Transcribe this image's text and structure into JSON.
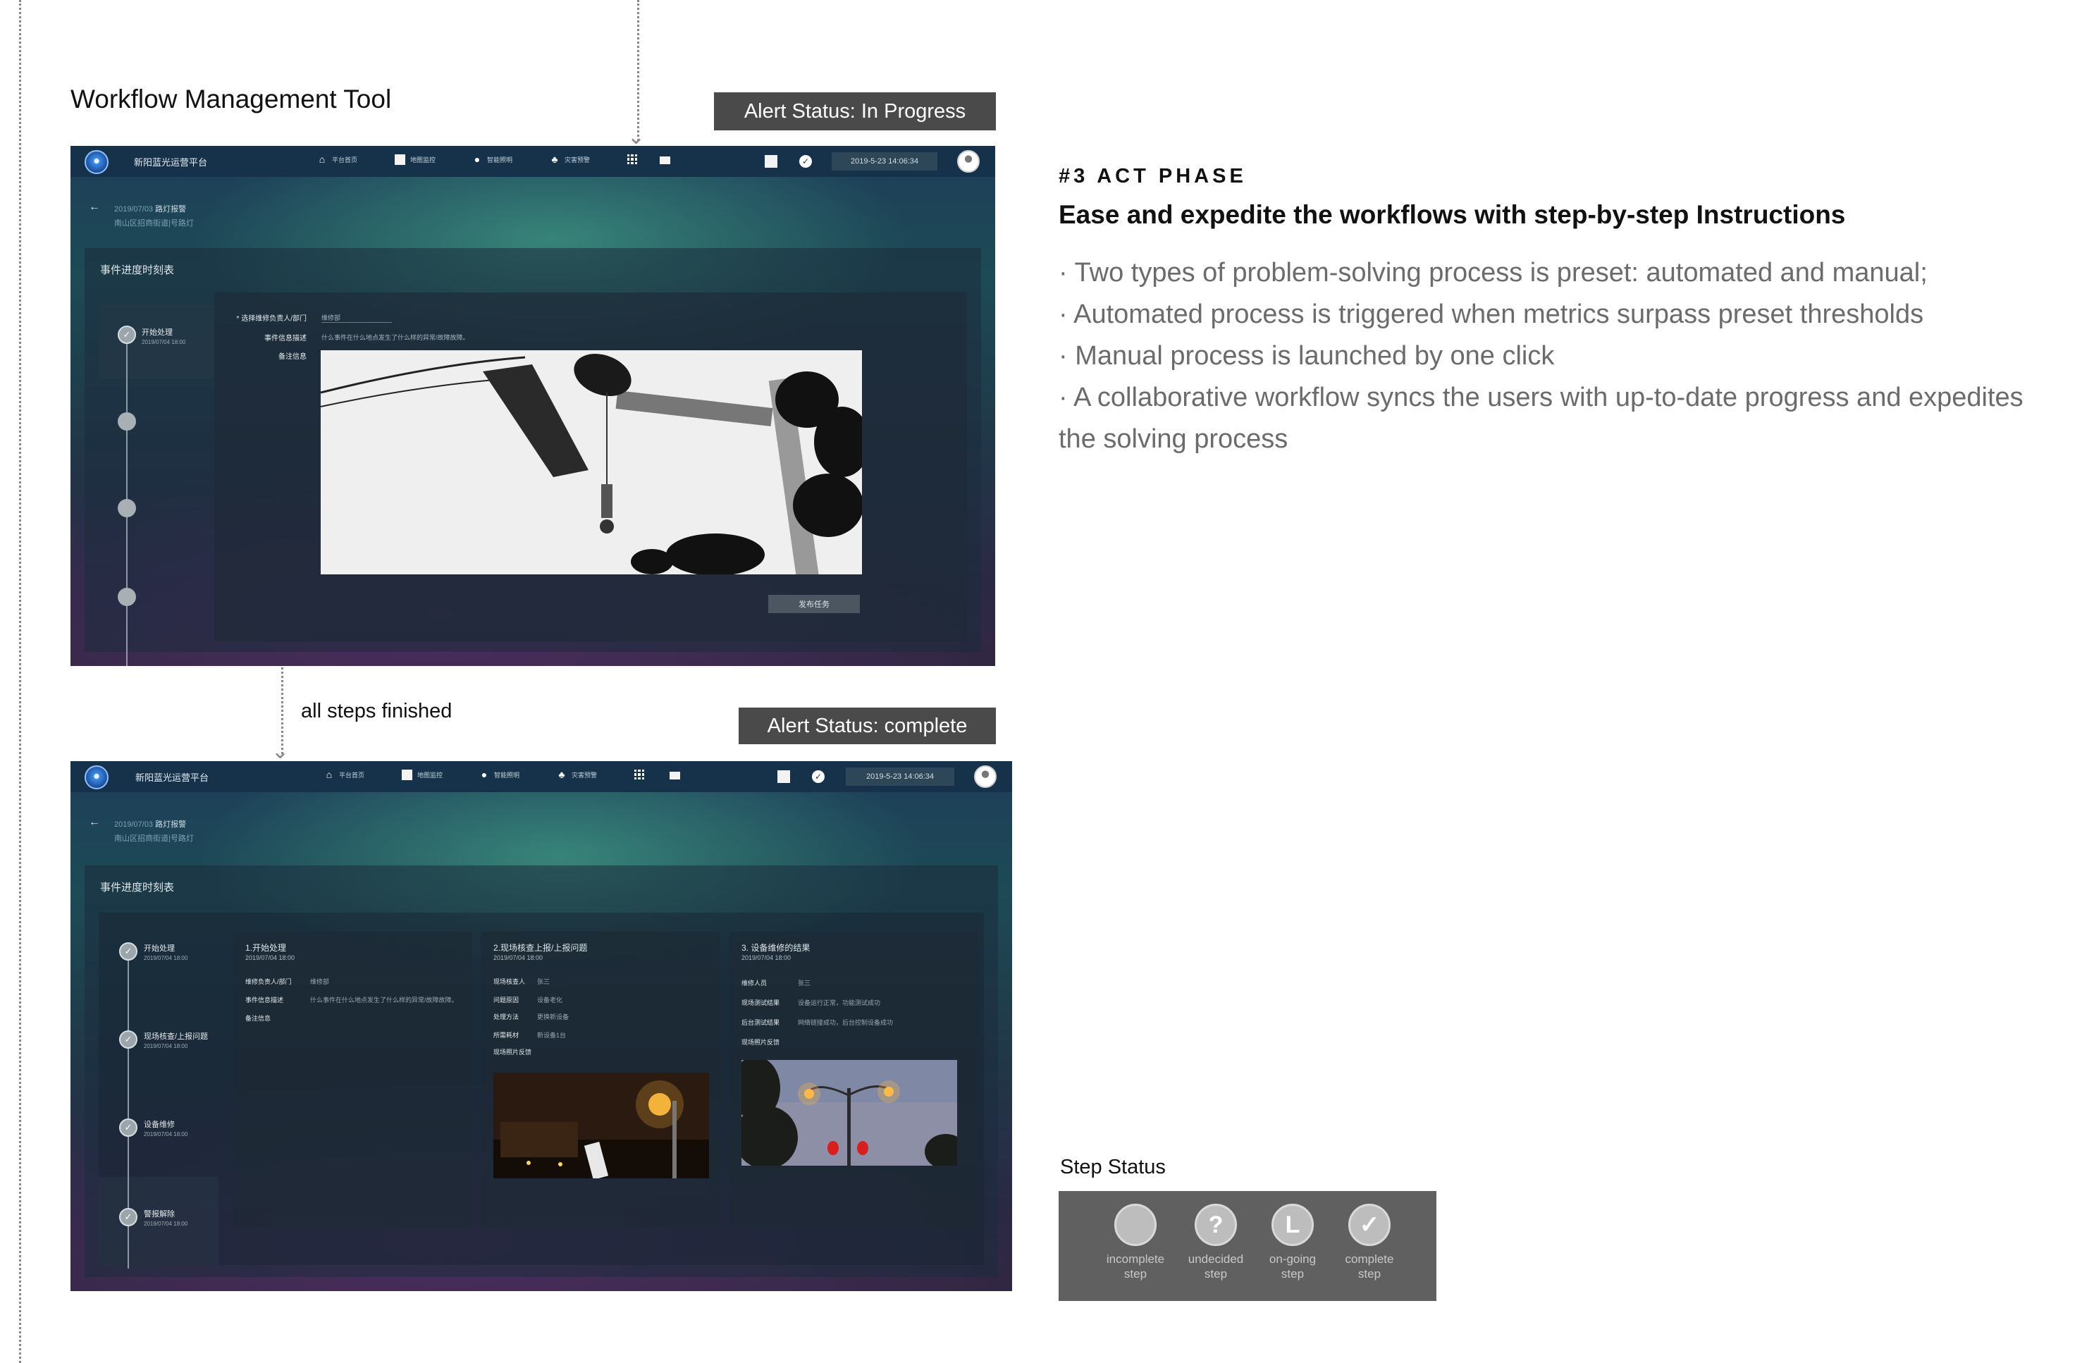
{
  "section_title": "Workflow Management Tool",
  "status_in_progress": "Alert Status: In Progress",
  "status_complete": "Alert Status: complete",
  "transition_label": "all steps finished",
  "phase_label": "#3 ACT PHASE",
  "headline": "Ease and expedite the workflows with step-by-step Instructions",
  "bullets": [
    "· Two types of problem-solving process is preset: automated and manual;",
    "· Automated process is triggered when metrics surpass preset thresholds",
    "· Manual process is launched by one click",
    "· A collaborative workflow syncs the users with up-to-date progress and expedites the solving process"
  ],
  "legend": {
    "title": "Step Status",
    "items": [
      {
        "icon": "incomplete-step-icon",
        "glyph": "",
        "label1": "incomplete",
        "label2": "step"
      },
      {
        "icon": "undecided-step-icon",
        "glyph": "?",
        "label1": "undecided",
        "label2": "step"
      },
      {
        "icon": "ongoing-step-icon",
        "glyph": "L",
        "label1": "on-going",
        "label2": "step"
      },
      {
        "icon": "complete-step-icon",
        "glyph": "✓",
        "label1": "complete",
        "label2": "step"
      }
    ]
  },
  "app": {
    "platform_name": "新阳蓝光运营平台",
    "nav": [
      "平台首页",
      "地图监控",
      "智能照明",
      "灾害预警"
    ],
    "datetime": "2019-5-23 14:06:34",
    "breadcrumb_date": "2019/07/03",
    "breadcrumb_title": "路灯报警",
    "breadcrumb_sub": "南山区招商街道|号路灯",
    "panel_title": "事件进度时刻表"
  },
  "screen1": {
    "step1_label": "开始处理",
    "step1_time": "2019/07/04   18:00",
    "form": {
      "owner_label": "* 选择维修负责人/部门",
      "owner_value": "维修部",
      "desc_label": "事件信息描述",
      "desc_value": "什么事件在什么地点发生了什么样的异常/故障故障。",
      "note_label": "备注信息"
    },
    "publish_button": "发布任务"
  },
  "screen2": {
    "steps": [
      {
        "label": "开始处理",
        "time": "2019/07/04   18:00"
      },
      {
        "label": "现场核查/上报问题",
        "time": "2019/07/04   18:00"
      },
      {
        "label": "设备维修",
        "time": "2019/07/04   18:00"
      },
      {
        "label": "警报解除",
        "time": "2019/07/04   18:00"
      }
    ],
    "card1": {
      "title": "1.开始处理",
      "date": "2019/07/04 18:00",
      "rows": [
        {
          "k": "维修负责人/部门",
          "v": "维修部"
        },
        {
          "k": "事件信息描述",
          "v": "什么事件在什么地点发生了什么样的异常/故障故障。"
        },
        {
          "k": "备注信息",
          "v": ""
        }
      ]
    },
    "card2": {
      "title": "2.现场核查上报/上报问题",
      "date": "2019/07/04 18:00",
      "rows": [
        {
          "k": "现场核查人",
          "v": "张三"
        },
        {
          "k": "问题原因",
          "v": "设备老化"
        },
        {
          "k": "处理方法",
          "v": "更换新设备"
        },
        {
          "k": "所需耗材",
          "v": "新设备1台"
        },
        {
          "k": "现场照片反馈",
          "v": ""
        }
      ]
    },
    "card3": {
      "title": "3. 设备维修的结果",
      "date": "2019/07/04    18:00",
      "rows": [
        {
          "k": "维修人员",
          "v": "张三"
        },
        {
          "k": "现场测试结果",
          "v": "设备运行正常，功能测试成功"
        },
        {
          "k": "后台测试结果",
          "v": "网络链接成功，后台控制设备成功"
        },
        {
          "k": "现场照片反馈",
          "v": ""
        }
      ]
    }
  }
}
